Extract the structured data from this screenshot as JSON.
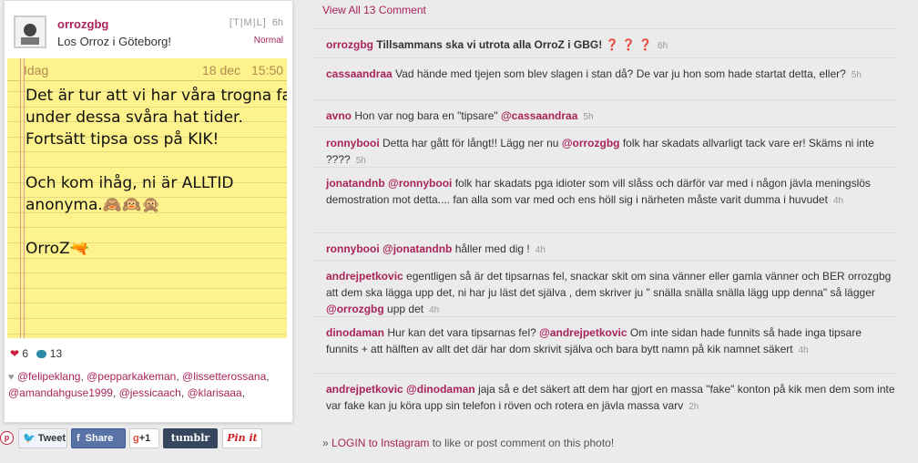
{
  "post": {
    "username": "orrozgbg",
    "caption": "Los Orroz i Göteborg!",
    "links": "[T|M|L]",
    "time": "6h",
    "filter": "Normal",
    "photo": {
      "day": "Idag",
      "date": "18 dec",
      "clock": "15:50",
      "lines": [
        "Det är tur att vi har våra trogna fans",
        "under dessa svåra hat tider.",
        "Fortsätt tipsa oss på KIK!",
        "",
        "Och kom ihåg, ni är ALLTID",
        "anonyma.🙈🙉🙊",
        "",
        "OrroZ🔫"
      ]
    },
    "likes": "6",
    "comments_count": "13",
    "likers": [
      "@felipeklang",
      "@pepparkakeman",
      "@lissetterossana",
      "@amandahguse1999",
      "@jessicaach",
      "@klarisaaa"
    ]
  },
  "share": {
    "tweet": "Tweet",
    "facebook": "Share",
    "gplus": "+1",
    "tumblr": "tumblr",
    "pinit": "Pin it"
  },
  "comments_header": "View All 13 Comment",
  "comments": [
    {
      "user": "orrozgbg",
      "parts": [
        {
          "t": "Tillsammans ska vi utrota alla OrroZ i GBG! "
        },
        {
          "q": "❓ ❓ ❓"
        }
      ],
      "time": "6h",
      "bold": true
    },
    {
      "user": "cassaandraa",
      "parts": [
        {
          "t": "Vad hände med tjejen som blev slagen i stan då? De var ju hon som hade startat detta, eller?"
        }
      ],
      "time": "5h"
    },
    {
      "user": "avno",
      "parts": [
        {
          "t": "Hon var nog bara en \"tipsare\" "
        },
        {
          "m": "@cassaandraa"
        }
      ],
      "time": "5h"
    },
    {
      "user": "ronnybooi",
      "parts": [
        {
          "t": "Detta har gått för långt!! Lägg ner nu "
        },
        {
          "m": "@orrozgbg"
        },
        {
          "t": " folk har skadats allvarligt tack vare er! Skäms ni inte ????"
        }
      ],
      "time": "5h"
    },
    {
      "user": "jonatandnb",
      "parts": [
        {
          "m": "@ronnybooi"
        },
        {
          "t": " folk har skadats pga idioter som vill slåss och därför var med i någon jävla meningslös demostration mot detta.... fan alla som var med och ens höll sig i närheten måste varit dumma i huvudet"
        }
      ],
      "time": "4h"
    },
    {
      "user": "ronnybooi",
      "parts": [
        {
          "m": "@jonatandnb"
        },
        {
          "t": " håller med dig !"
        }
      ],
      "time": "4h"
    },
    {
      "user": "andrejpetkovic",
      "parts": [
        {
          "t": "egentligen så är det tipsarnas fel, snackar skit om sina vänner eller gamla vänner och BER orrozgbg att dem ska lägga upp det, ni har ju läst det själva , dem skriver ju \" snälla snälla snälla lägg upp denna\" så lägger "
        },
        {
          "m": "@orrozgbg"
        },
        {
          "t": " upp det"
        }
      ],
      "time": "4h"
    },
    {
      "user": "dinodaman",
      "parts": [
        {
          "t": "Hur kan det vara tipsarnas fel? "
        },
        {
          "m": "@andrejpetkovic"
        },
        {
          "t": " Om inte sidan hade funnits så hade inga tipsare funnits + att hälften av allt det där har dom skrivit själva och bara bytt namn på kik namnet säkert"
        }
      ],
      "time": "4h"
    },
    {
      "user": "andrejpetkovic",
      "parts": [
        {
          "m": "@dinodaman"
        },
        {
          "t": " jaja så e det säkert att dem har gjort en massa \"fake\" konton på kik men dem som inte var fake kan ju köra upp sin telefon i röven och rotera en jävla massa varv"
        }
      ],
      "time": "2h"
    }
  ],
  "login": {
    "prefix": "» ",
    "link": "LOGIN to Instagram",
    "suffix": " to like or post comment on this photo!"
  },
  "colors": {
    "accent": "#a9245a",
    "note": "#fdf28c",
    "bg": "#ebebeb"
  }
}
